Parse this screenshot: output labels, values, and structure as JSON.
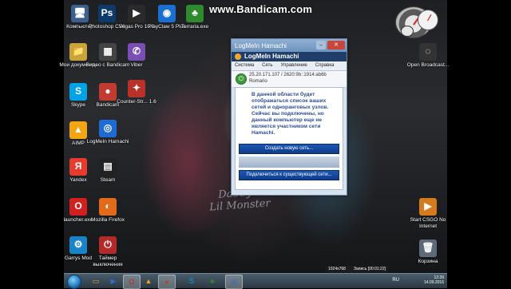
{
  "watermark": "www.Bandicam.com",
  "wallpaper_text": [
    "Daddy's",
    "Lil Monster"
  ],
  "desktop_icons": [
    {
      "name": "computer",
      "label": "Компьютер",
      "glyph": "🖥",
      "color": "#3b5f8f"
    },
    {
      "name": "photoshop",
      "label": "Photoshop CS6",
      "glyph": "Ps",
      "color": "#0d3a6b"
    },
    {
      "name": "vegas",
      "label": "Vegas Pro 10.0",
      "glyph": "▶",
      "color": "#2a2a2a"
    },
    {
      "name": "playclaw",
      "label": "PlayClaw 5 Plus",
      "glyph": "◉",
      "color": "#1a6fd0"
    },
    {
      "name": "terraria",
      "label": "Terraria.exe",
      "glyph": "♣",
      "color": "#2d8a2d"
    },
    {
      "name": "documents",
      "label": "Мои документы",
      "glyph": "📁",
      "color": "#c9a43c"
    },
    {
      "name": "clips",
      "label": "Видео с Bandicam",
      "glyph": "▦",
      "color": "#444"
    },
    {
      "name": "viber",
      "label": "Viber",
      "glyph": "✆",
      "color": "#7a4fb3"
    },
    {
      "name": "skype",
      "label": "Skype",
      "glyph": "S",
      "color": "#00a3e6"
    },
    {
      "name": "bandicam",
      "label": "Bandicam",
      "glyph": "●",
      "color": "#c23b2e"
    },
    {
      "name": "counter-strike",
      "label": "Counter-Str... 1.6",
      "glyph": "✦",
      "color": "#b8322b"
    },
    {
      "name": "aimp",
      "label": "AIMP",
      "glyph": "▲",
      "color": "#f2a614"
    },
    {
      "name": "hamachi",
      "label": "LogMeIn Hamachi",
      "glyph": "◎",
      "color": "#1e6bd6"
    },
    {
      "name": "yandex",
      "label": "Yandex",
      "glyph": "Я",
      "color": "#e63b2e"
    },
    {
      "name": "steam",
      "label": "Steam",
      "glyph": "▤",
      "color": "#222"
    },
    {
      "name": "launcher",
      "label": "launcher.exe",
      "glyph": "O",
      "color": "#d21f1f"
    },
    {
      "name": "firefox",
      "label": "Mozilla Firefox",
      "glyph": "◐",
      "color": "#e36a1b"
    },
    {
      "name": "garrys-mod",
      "label": "Garrys Mod",
      "glyph": "⚙",
      "color": "#1a84c9"
    },
    {
      "name": "shutdown-timer",
      "label": "Таймер выключения",
      "glyph": "⏻",
      "color": "#b32a2a"
    },
    {
      "name": "open-broadcast",
      "label": "Open Broadcast...",
      "glyph": "◌",
      "color": "#333"
    },
    {
      "name": "start-csgo",
      "label": "Start CSGO No Internet",
      "glyph": "▶",
      "color": "#d57a1d"
    },
    {
      "name": "recycle-bin",
      "label": "Корзина",
      "glyph": "🗑",
      "color": "#5c6a7a"
    }
  ],
  "hamachi": {
    "title": "LogMeIn Hamachi",
    "logo": "LogMeIn Hamachi",
    "menu": [
      "Система",
      "Сеть",
      "Управление",
      "Справка"
    ],
    "ip": "25.20.171.107 / 2620:9b::1914:ab6b",
    "user": "Romario",
    "message": "В данной области будет отображаться список ваших сетей и одноранговых узлов. Сейчас вы подключены, но данный компьютер еще не является участником сети Hamachi.",
    "create_button": "Создать новую сеть...",
    "join_button": "Подключиться к существующей сети..."
  },
  "recording_bar": {
    "resolution": "1024x768",
    "record": "Запись [00:01:22]"
  },
  "taskbar": {
    "language": "RU",
    "time": "12:39",
    "date": "14.09.2016",
    "buttons": [
      {
        "name": "explorer",
        "glyph": "▭",
        "color": "#d9a73a"
      },
      {
        "name": "media",
        "glyph": "▶",
        "color": "#2b6cd6"
      },
      {
        "name": "opera",
        "glyph": "O",
        "color": "#d01f1f"
      },
      {
        "name": "aimp",
        "glyph": "▲",
        "color": "#f2a614"
      },
      {
        "name": "bandicam",
        "glyph": "●",
        "color": "#c23b2e"
      },
      {
        "name": "skype",
        "glyph": "S",
        "color": "#00a3e6"
      },
      {
        "name": "terraria",
        "glyph": "♣",
        "color": "#2d8a2d"
      },
      {
        "name": "hamachi",
        "glyph": "◎",
        "color": "#1e6bd6"
      }
    ]
  }
}
